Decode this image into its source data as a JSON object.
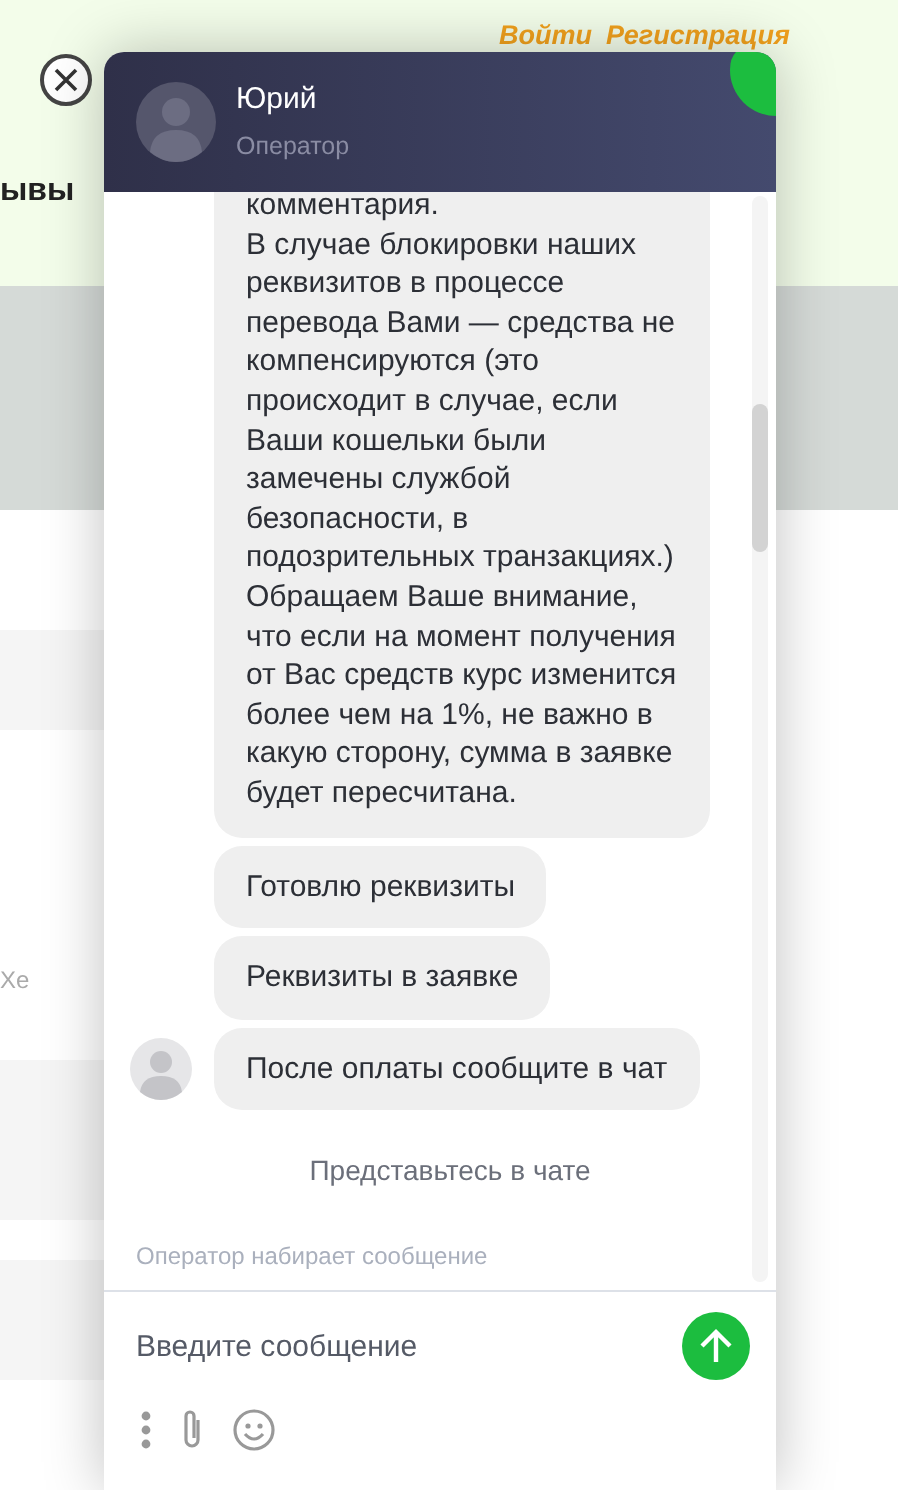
{
  "page": {
    "nav_links": [
      "Войти",
      "Регистрация"
    ],
    "heading_fragment": "ывы",
    "text_fragment": "Xe"
  },
  "chat": {
    "operator": {
      "name": "Юрий",
      "role": "Оператор"
    },
    "messages": [
      {
        "text": "комментария.\nВ случае блокировки наших реквизитов в процессе перевода Вами — средства не компенсируются (это происходит в случае, если Ваши кошельки были замечены службой безопасности, в подозрительных транзакциях.)\nОбращаем Ваше внимание, что если на момент получения от Вас средств курс изменится более чем на 1%, не важно в какую сторону, сумма в заявке будет пересчитана.",
        "avatar": false
      },
      {
        "text": "Готовлю реквизиты",
        "avatar": false
      },
      {
        "text": "Реквизиты в заявке",
        "avatar": false
      },
      {
        "text": "После оплаты сообщите в чат",
        "avatar": true
      }
    ],
    "system_notice": "Представьтесь в чате",
    "typing_status": "Оператор набирает сообщение",
    "input": {
      "placeholder": "Введите сообщение"
    }
  }
}
